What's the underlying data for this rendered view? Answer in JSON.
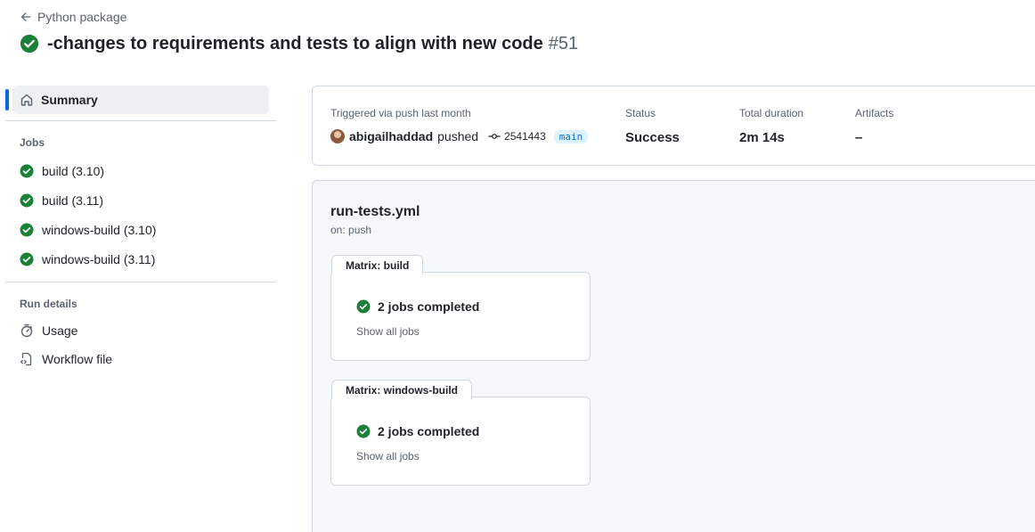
{
  "back_link": "Python package",
  "run_title": "-changes to requirements and tests to align with new code",
  "run_number": "#51",
  "colors": {
    "success": "#1a7f37",
    "accent": "#0969da"
  },
  "sidebar": {
    "summary_label": "Summary",
    "jobs_heading": "Jobs",
    "jobs": [
      {
        "label": "build (3.10)",
        "status": "success"
      },
      {
        "label": "build (3.11)",
        "status": "success"
      },
      {
        "label": "windows-build (3.10)",
        "status": "success"
      },
      {
        "label": "windows-build (3.11)",
        "status": "success"
      }
    ],
    "run_details_heading": "Run details",
    "usage_label": "Usage",
    "workflow_file_label": "Workflow file"
  },
  "summary": {
    "trigger_text": "Triggered via push last month",
    "actor": "abigailhaddad",
    "action": "pushed",
    "commit": "2541443",
    "branch": "main",
    "status_label": "Status",
    "status_value": "Success",
    "duration_label": "Total duration",
    "duration_value": "2m 14s",
    "artifacts_label": "Artifacts",
    "artifacts_value": "–"
  },
  "workflow": {
    "file": "run-tests.yml",
    "on": "on: push",
    "matrices": [
      {
        "tab": "Matrix: build",
        "jobs_text": "2 jobs completed",
        "show_all": "Show all jobs"
      },
      {
        "tab": "Matrix: windows-build",
        "jobs_text": "2 jobs completed",
        "show_all": "Show all jobs"
      }
    ]
  }
}
